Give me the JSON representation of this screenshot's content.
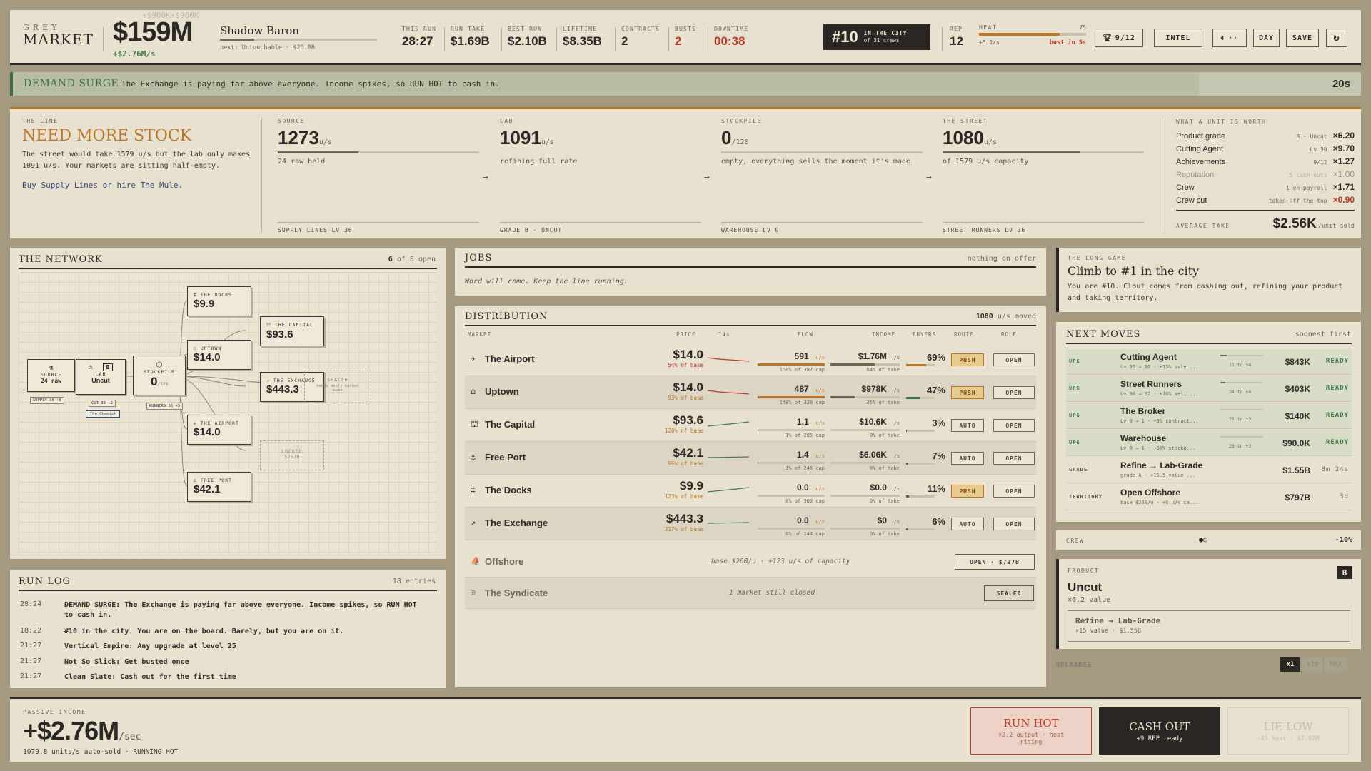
{
  "topbar": {
    "brand_top": "GREY",
    "brand_bottom": "MARKET",
    "cash": "$159M",
    "cash_rate": "+$2.76M/s",
    "ghost_gains": "+$900K+$900K",
    "boss_name": "Shadow Baron",
    "boss_progress": 0.22,
    "boss_next": "next: Untouchable · $25.0B",
    "stats": [
      {
        "label": "THIS RUN",
        "value": "28:27"
      },
      {
        "label": "RUN TAKE",
        "value": "$1.69B"
      },
      {
        "label": "BEST RUN",
        "value": "$2.10B"
      },
      {
        "label": "LIFETIME",
        "value": "$8.35B"
      },
      {
        "label": "CONTRACTS",
        "value": "2"
      },
      {
        "label": "BUSTS",
        "value": "2"
      },
      {
        "label": "DOWNTIME",
        "value": "00:38"
      }
    ],
    "rank": "#10",
    "rank_line1": "IN THE CITY",
    "rank_line2": "of 31 crews",
    "rep_label": "REP",
    "rep_value": "12",
    "heat_label": "HEAT",
    "heat_value": "75",
    "heat_level": 0.75,
    "heat_rate": "+5.1/s",
    "heat_warning": "bust in 5s",
    "trophy": "9/12",
    "intel": "INTEL",
    "sound": "··",
    "day": "DAY",
    "save": "SAVE",
    "reset_icon": "↻"
  },
  "banner": {
    "title": "DEMAND SURGE",
    "text": "The Exchange is paying far above everyone. Income spikes, so RUN HOT to cash in.",
    "timer": "20s",
    "remaining": 0.88
  },
  "line": {
    "kicker": "THE LINE",
    "headline": "NEED MORE STOCK",
    "desc": "The street would take 1579 u/s but the lab only makes 1091 u/s. Your markets are sitting half-empty.",
    "cta": "Buy Supply Lines or hire The Mule.",
    "source": {
      "label": "SOURCE",
      "value": "1273",
      "unit": "u/s",
      "sub": "24 raw held",
      "fill": 0.4,
      "foot": "SUPPLY LINES Lv 36"
    },
    "lab": {
      "label": "LAB",
      "value": "1091",
      "unit": "u/s",
      "sub": "refining full rate",
      "foot": "GRADE B · UNCUT"
    },
    "stockpile": {
      "label": "STOCKPILE",
      "value": "0",
      "unit": "/120",
      "sub": "empty, everything sells the moment it's made",
      "foot": "WAREHOUSE Lv 0"
    },
    "street": {
      "label": "THE STREET",
      "value": "1080",
      "unit": "u/s",
      "sub": "of 1579 u/s capacity",
      "fill": 0.68,
      "foot": "STREET RUNNERS Lv 36"
    },
    "worth_title": "WHAT A UNIT IS WORTH",
    "multipliers": [
      {
        "name": "Product grade",
        "desc": "B · Uncut",
        "value": "×6.20"
      },
      {
        "name": "Cutting Agent",
        "desc": "Lv 39",
        "value": "×9.70"
      },
      {
        "name": "Achievements",
        "desc": "9/12",
        "value": "×1.27"
      },
      {
        "name": "Reputation",
        "desc": "5 cash-outs",
        "value": "×1.00"
      },
      {
        "name": "Crew",
        "desc": "1 on payroll",
        "value": "×1.71"
      },
      {
        "name": "Crew cut",
        "desc": "taken off the top",
        "value": "×0.90"
      }
    ],
    "avg_label": "AVERAGE TAKE",
    "avg_value": "$2.56K",
    "avg_unit": "/unit sold"
  },
  "network": {
    "title": "THE NETWORK",
    "open_count": "6",
    "open_total": "of 8 open",
    "source": {
      "label": "SOURCE",
      "value": "24 raw"
    },
    "lab": {
      "label": "LAB",
      "value": "Uncut",
      "grade": "B"
    },
    "stockpile": {
      "label": "STOCKPILE",
      "value": "0",
      "unit": "/120"
    },
    "tag_supply": "SUPPLY 36 +6",
    "tag_cut": "CUT 39 +2",
    "tag_chemist": "The Chemist",
    "tag_runners": "RUNNERS 36 +5",
    "docks": {
      "label": "THE DOCKS",
      "value": "$9.9"
    },
    "uptown": {
      "label": "UPTOWN",
      "value": "$14.0"
    },
    "airport": {
      "label": "THE AIRPORT",
      "value": "$14.0"
    },
    "freeport": {
      "label": "FREE PORT",
      "value": "$42.1"
    },
    "capital": {
      "label": "THE CAPITAL",
      "value": "$93.6"
    },
    "exchange": {
      "label": "THE EXCHANGE",
      "value": "$443.3"
    },
    "sealed": {
      "label": "SEALED",
      "sub": "needs every market open"
    },
    "locked": {
      "label": "LOCKED",
      "sub": "$797B"
    }
  },
  "runlog": {
    "title": "RUN LOG",
    "count": "18 entries",
    "entries": [
      {
        "time": "28:24",
        "msg": "DEMAND SURGE: The Exchange is paying far above everyone. Income spikes, so RUN HOT to cash in."
      },
      {
        "time": "18:22",
        "msg": "#10 in the city. You are on the board. Barely, but you are on it."
      },
      {
        "time": "21:27",
        "msg": "Vertical Empire: Any upgrade at level 25"
      },
      {
        "time": "21:27",
        "msg": "Not So Slick: Get busted once"
      },
      {
        "time": "21:27",
        "msg": "Clean Slate: Cash out for the first time"
      }
    ]
  },
  "jobs": {
    "title": "JOBS",
    "status": "nothing on offer",
    "note": "Word will come. Keep the line running."
  },
  "distribution": {
    "title": "DISTRIBUTION",
    "moved_value": "1080",
    "moved_unit": "u/s moved",
    "headers": [
      "MARKET",
      "PRICE",
      "14s",
      "FLOW",
      "INCOME",
      "BUYERS",
      "ROUTE",
      "ROLE"
    ],
    "rows": [
      {
        "icon": "✈",
        "name": "The Airport",
        "price": "$14.0",
        "price_sub": "54% of base",
        "price_red": true,
        "flow": "591",
        "flow_unit": "u/s",
        "flow_sub": "150% of 387 cap",
        "flow_fill": 1.0,
        "income": "$1.76M",
        "income_unit": "/s",
        "income_sub": "64% of take",
        "income_fill": 0.64,
        "buyers": "69%",
        "buyers_fill": 0.69,
        "route": "PUSH",
        "role": "OPEN",
        "spark": "down"
      },
      {
        "icon": "⌂",
        "name": "Uptown",
        "price": "$14.0",
        "price_sub": "93% of base",
        "price_red": false,
        "flow": "487",
        "flow_unit": "u/s",
        "flow_sub": "148% of 328 cap",
        "flow_fill": 1.0,
        "income": "$978K",
        "income_unit": "/s",
        "income_sub": "35% of take",
        "income_fill": 0.35,
        "buyers": "47%",
        "buyers_fill": 0.47,
        "route": "PUSH",
        "role": "OPEN",
        "spark": "down"
      },
      {
        "icon": "⛫",
        "name": "The Capital",
        "price": "$93.6",
        "price_sub": "120% of base",
        "price_red": false,
        "flow": "1.1",
        "flow_unit": "u/s",
        "flow_sub": "1% of 205 cap",
        "flow_fill": 0.01,
        "income": "$10.6K",
        "income_unit": "/s",
        "income_sub": "0% of take",
        "income_fill": 0.0,
        "buyers": "3%",
        "buyers_fill": 0.03,
        "route": "AUTO",
        "role": "OPEN",
        "spark": "up"
      },
      {
        "icon": "⚓",
        "name": "Free Port",
        "price": "$42.1",
        "price_sub": "96% of base",
        "price_red": false,
        "flow": "1.4",
        "flow_unit": "u/s",
        "flow_sub": "1% of 246 cap",
        "flow_fill": 0.01,
        "income": "$6.06K",
        "income_unit": "/s",
        "income_sub": "0% of take",
        "income_fill": 0.0,
        "buyers": "7%",
        "buyers_fill": 0.07,
        "route": "AUTO",
        "role": "OPEN",
        "spark": "flat"
      },
      {
        "icon": "‡",
        "name": "The Docks",
        "price": "$9.9",
        "price_sub": "123% of base",
        "price_red": false,
        "flow": "0.0",
        "flow_unit": "u/s",
        "flow_sub": "0% of 369 cap",
        "flow_fill": 0.0,
        "income": "$0.0",
        "income_unit": "/s",
        "income_sub": "0% of take",
        "income_fill": 0.0,
        "buyers": "11%",
        "buyers_fill": 0.11,
        "route": "PUSH",
        "role": "OPEN",
        "spark": "up"
      },
      {
        "icon": "↗",
        "name": "The Exchange",
        "price": "$443.3",
        "price_sub": "317% of base",
        "price_red": false,
        "flow": "0.0",
        "flow_unit": "u/s",
        "flow_sub": "0% of 144 cap",
        "flow_fill": 0.0,
        "income": "$0",
        "income_unit": "/s",
        "income_sub": "0% of take",
        "income_fill": 0.0,
        "buyers": "6%",
        "buyers_fill": 0.06,
        "route": "AUTO",
        "role": "OPEN",
        "spark": "flat"
      }
    ],
    "offshore": {
      "icon": "⛵",
      "name": "Offshore",
      "note": "base $260/u · +123 u/s of capacity",
      "action": "OPEN · $797B"
    },
    "syndicate": {
      "icon": "◎",
      "name": "The Syndicate",
      "note": "1 market still closed",
      "action": "SEALED"
    }
  },
  "longgame": {
    "kicker": "THE LONG GAME",
    "title": "Climb to #1 in the city",
    "desc": "You are #10. Clout comes from cashing out, refining your product and taking territory."
  },
  "nextmoves": {
    "title": "NEXT MOVES",
    "sort": "soonest first",
    "items": [
      {
        "kind": "UPG",
        "name": "Cutting Agent",
        "sub": "Lv 39 → 30 · +15% sale ...",
        "lv": "21 to +4",
        "cost": "$843K",
        "status": "READY",
        "fill": 0.15
      },
      {
        "kind": "UPG",
        "name": "Street Runners",
        "sub": "Lv 36 → 37 · +16% sell ...",
        "lv": "24 to +4",
        "cost": "$403K",
        "status": "READY",
        "fill": 0.12
      },
      {
        "kind": "UPG",
        "name": "The Broker",
        "sub": "Lv 0 → 1 · +3% contract...",
        "lv": "25 to +3",
        "cost": "$140K",
        "status": "READY",
        "fill": 0.0
      },
      {
        "kind": "UPG",
        "name": "Warehouse",
        "sub": "Lv 0 → 1 · +30% stockp...",
        "lv": "25 to +3",
        "cost": "$90.0K",
        "status": "READY",
        "fill": 0.0
      },
      {
        "kind": "GRADE",
        "name": "Refine → Lab-Grade",
        "sub": "grade A · ×15.5 value ...",
        "lv": "",
        "cost": "$1.55B",
        "status": "8m 24s",
        "fill": 0.0
      },
      {
        "kind": "TERRITORY",
        "name": "Open Offshore",
        "sub": "base $260/u · +6 u/s ca...",
        "lv": "",
        "cost": "$797B",
        "status": "3d",
        "fill": 0.0
      }
    ]
  },
  "crew": {
    "label": "CREW",
    "cut": "-10%"
  },
  "product": {
    "kicker": "PRODUCT",
    "grade": "B",
    "name": "Uncut",
    "value": "×6.2 value",
    "refine_title": "Refine → Lab-Grade",
    "refine_sub": "×15 value · $1.55B"
  },
  "upgrades": {
    "label": "UPGRADES",
    "x1": "x1",
    "x10": "x10",
    "max": "MAX"
  },
  "bottom": {
    "kicker": "PASSIVE INCOME",
    "income": "+$2.76M",
    "unit": "/sec",
    "sub": "1079.8 units/s auto-sold · RUNNING HOT",
    "run_hot": "RUN HOT",
    "run_hot_sub": "×2.2 output · heat rising",
    "cash_out": "CASH OUT",
    "cash_out_sub": "+9 REP ready",
    "lie_low": "LIE LOW",
    "lie_low_sub": "-45 heat · $7.07M"
  }
}
